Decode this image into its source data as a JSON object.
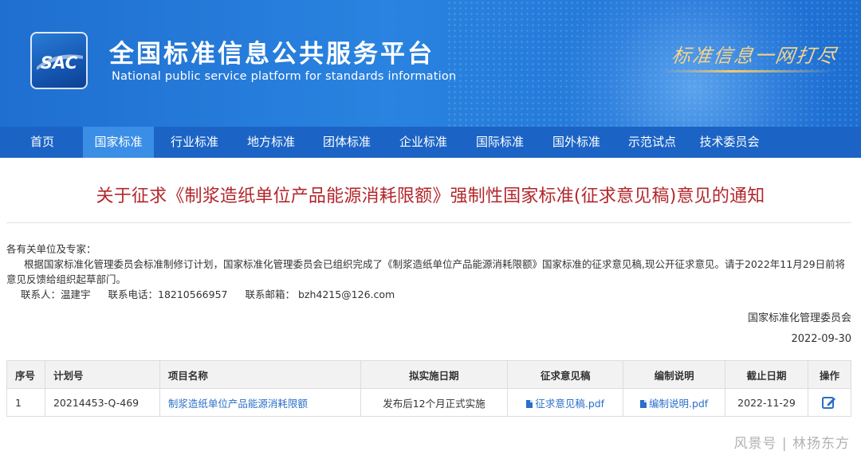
{
  "header": {
    "logo_text": "SAC",
    "site_title": "全国标准信息公共服务平台",
    "site_subtitle": "National public service platform  for standards information",
    "slogan": "标准信息一网打尽",
    "colors": {
      "banner": "#2a83e0",
      "nav": "#1b64c5",
      "nav_active": "#3a8ee6",
      "slogan": "#f5d48a"
    }
  },
  "nav": {
    "items": [
      {
        "label": "首页"
      },
      {
        "label": "国家标准",
        "active": true
      },
      {
        "label": "行业标准"
      },
      {
        "label": "地方标准"
      },
      {
        "label": "团体标准"
      },
      {
        "label": "企业标准"
      },
      {
        "label": "国际标准"
      },
      {
        "label": "国外标准"
      },
      {
        "label": "示范试点"
      },
      {
        "label": "技术委员会"
      }
    ]
  },
  "article": {
    "title": "关于征求《制浆造纸单位产品能源消耗限额》强制性国家标准(征求意见稿)意见的通知",
    "title_color": "#b3262b",
    "greeting": "各有关单位及专家：",
    "paragraph": "根据国家标准化管理委员会标准制修订计划，国家标准化管理委员会已组织完成了《制浆造纸单位产品能源消耗限额》国家标准的征求意见稿,现公开征求意见。请于2022年11月29日前将意见反馈给组织起草部门。",
    "contact": {
      "person": "联系人：温建宇",
      "phone": "联系电话：18210566957",
      "email": "联系邮箱：  bzh4215@126.com"
    },
    "signer": "国家标准化管理委员会",
    "date": "2022-09-30"
  },
  "table": {
    "headers": [
      "序号",
      "计划号",
      "项目名称",
      "拟实施日期",
      "征求意见稿",
      "编制说明",
      "截止日期",
      "操作"
    ],
    "rows": [
      {
        "index": "1",
        "plan_no": "20214453-Q-469",
        "project_name": "制浆造纸单位产品能源消耗限额",
        "implement_date": "发布后12个月正式实施",
        "draft_file": "征求意见稿.pdf",
        "explanation_file": "编制说明.pdf",
        "deadline": "2022-11-29",
        "action_icon": "edit-icon"
      }
    ]
  },
  "watermark": "风景号 | 林扬东方"
}
